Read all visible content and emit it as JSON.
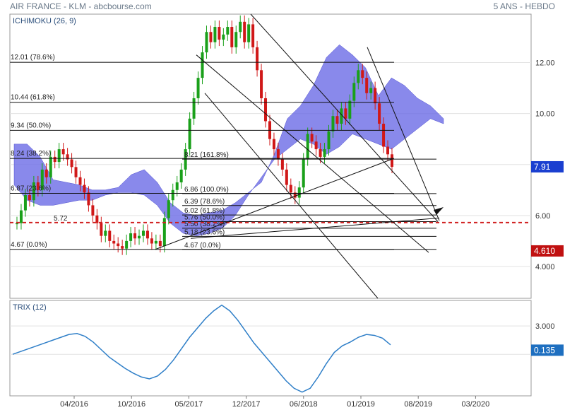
{
  "header": {
    "title": "AIR FRANCE - KLM - abcbourse.com",
    "period": "5 ANS - HEBDO"
  },
  "chart_data": [
    {
      "type": "candlestick",
      "indicator_label": "ICHIMOKU (26, 9)",
      "ylim": [
        2.75,
        13.9
      ],
      "y_ticks": [
        "4.000",
        "6.00",
        "8.00",
        "10.00",
        "12.00"
      ],
      "x_ticks": [
        "04/2016",
        "10/2016",
        "05/2017",
        "12/2017",
        "06/2018",
        "01/2019",
        "08/2019",
        "03/2020"
      ],
      "last_price": "7.91",
      "price_tag_color": "#1a3fd0",
      "support_tag": "4.610",
      "support_tag_color": "#c01010",
      "dashed_level": {
        "label": "5.72",
        "value": 5.72,
        "color": "#d02020"
      },
      "candles_close": [
        5.7,
        6.2,
        6.8,
        6.6,
        7.3,
        7.0,
        7.8,
        7.5,
        8.3,
        8.1,
        8.6,
        8.4,
        8.2,
        7.9,
        7.5,
        7.2,
        6.9,
        6.4,
        6.0,
        5.7,
        5.2,
        5.4,
        5.0,
        4.9,
        4.8,
        4.7,
        5.0,
        5.3,
        5.1,
        5.2,
        5.4,
        5.1,
        4.9,
        5.0,
        4.8,
        5.9,
        6.6,
        7.0,
        7.3,
        7.8,
        8.6,
        9.8,
        10.6,
        11.4,
        12.4,
        13.2,
        12.8,
        13.4,
        12.9,
        13.1,
        13.4,
        12.6,
        13.2,
        13.6,
        12.8,
        13.5,
        12.6,
        11.7,
        10.6,
        9.7,
        9.0,
        8.6,
        8.2,
        7.8,
        7.2,
        6.9,
        6.7,
        7.1,
        8.2,
        9.2,
        8.9,
        8.6,
        8.3,
        8.6,
        9.3,
        9.9,
        9.6,
        10.2,
        9.8,
        10.5,
        11.2,
        11.7,
        11.4,
        10.8,
        11.0,
        10.4,
        9.6,
        8.7,
        8.4,
        7.91
      ],
      "fibonacci_left": [
        {
          "label": "12.01",
          "pct": "(78.6%)",
          "value": 12.01
        },
        {
          "label": "10.44",
          "pct": "(61.8%)",
          "value": 10.44
        },
        {
          "label": "9.34",
          "pct": "(50.0%)",
          "value": 9.34
        },
        {
          "label": "8.24",
          "pct": "(38.2%)",
          "value": 8.24
        },
        {
          "label": "6.87",
          "pct": "(23.6%)",
          "value": 6.87
        },
        {
          "label": "4.67",
          "pct": "(0.0%)",
          "value": 4.67
        }
      ],
      "fibonacci_right": [
        {
          "label": "8.21",
          "pct": "(161.8%)",
          "value": 8.21
        },
        {
          "label": "6.86",
          "pct": "(100.0%)",
          "value": 6.86
        },
        {
          "label": "6.39",
          "pct": "(78.6%)",
          "value": 6.39
        },
        {
          "label": "6.02",
          "pct": "(61.8%)",
          "value": 6.02
        },
        {
          "label": "5.76",
          "pct": "(50.0%)",
          "value": 5.76
        },
        {
          "label": "5.50",
          "pct": "(38.2%)",
          "value": 5.5
        },
        {
          "label": "5.18",
          "pct": "(23.6%)",
          "value": 5.18
        },
        {
          "label": "4.67",
          "pct": "(0.0%)",
          "value": 4.67
        }
      ]
    },
    {
      "type": "line",
      "indicator_label": "TRIX (12)",
      "y_ticks": [
        "3.000"
      ],
      "last_value": "0.135",
      "value_tag_color": "#1e6fc0",
      "values": [
        0.0,
        0.3,
        0.6,
        0.9,
        1.2,
        1.5,
        1.8,
        2.1,
        2.2,
        1.9,
        1.3,
        0.5,
        -0.3,
        -0.9,
        -1.5,
        -2.0,
        -2.4,
        -2.6,
        -2.3,
        -1.6,
        -0.6,
        0.6,
        1.8,
        2.8,
        3.8,
        4.6,
        5.2,
        4.6,
        3.6,
        2.4,
        1.2,
        0.2,
        -0.8,
        -1.8,
        -2.8,
        -3.6,
        -4.0,
        -3.6,
        -2.4,
        -1.0,
        0.2,
        0.9,
        1.3,
        1.8,
        2.1,
        2.0,
        1.7,
        1.0
      ]
    }
  ]
}
